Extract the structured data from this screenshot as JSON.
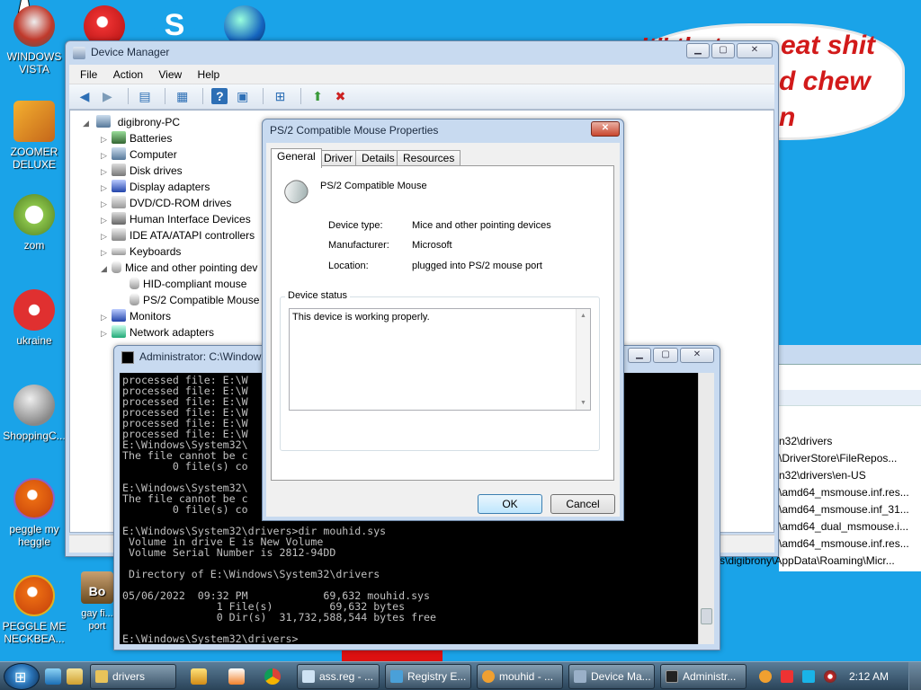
{
  "desktop": {
    "icons": [
      {
        "label": "WINDOWS VISTA",
        "icon": "windows-vista-icon",
        "color": "#c0392b"
      },
      {
        "label": "ZOOMER DELUXE",
        "icon": "zoomer-icon",
        "color": "#e08a1e"
      },
      {
        "label": "zom",
        "icon": "zombie-plant-icon",
        "color": "#8bc34a"
      },
      {
        "label": "ukraine",
        "icon": "radiation-icon",
        "color": "#e03030"
      },
      {
        "label": "ShoppingC...",
        "icon": "flash-icon",
        "color": "#777777"
      },
      {
        "label": "peggle my heggle",
        "icon": "peggle-icon",
        "color": "#ea6b12"
      },
      {
        "label": "PEGGLE ME NECKBEA...",
        "icon": "peggle-icon",
        "color": "#ea6b12"
      }
    ],
    "top_icons": [
      "peggle-icon",
      "skype-icon",
      "globe-icon"
    ],
    "partial_icon_text": "Bo",
    "partial_icon_label": "gay fi...",
    "partial_icon_label2": "port",
    "bubble_lines": [
      "It'' that",
      "eat shit",
      "d chew",
      "n"
    ]
  },
  "device_manager": {
    "title": "Device Manager",
    "menu": [
      "File",
      "Action",
      "View",
      "Help"
    ],
    "root": "digibrony-PC",
    "tree": [
      {
        "label": "Batteries",
        "expanded": false
      },
      {
        "label": "Computer",
        "expanded": false
      },
      {
        "label": "Disk drives",
        "expanded": false
      },
      {
        "label": "Display adapters",
        "expanded": false
      },
      {
        "label": "DVD/CD-ROM drives",
        "expanded": false
      },
      {
        "label": "Human Interface Devices",
        "expanded": false
      },
      {
        "label": "IDE ATA/ATAPI controllers",
        "expanded": false
      },
      {
        "label": "Keyboards",
        "expanded": false
      },
      {
        "label": "Mice and other pointing dev",
        "expanded": true
      },
      {
        "label": "HID-compliant mouse",
        "child": true
      },
      {
        "label": "PS/2 Compatible Mouse",
        "child": true
      },
      {
        "label": "Monitors",
        "expanded": false
      },
      {
        "label": "Network adapters",
        "expanded": false
      }
    ]
  },
  "properties_dialog": {
    "title": "PS/2 Compatible Mouse Properties",
    "tabs": [
      "General",
      "Driver",
      "Details",
      "Resources"
    ],
    "device_name": "PS/2 Compatible Mouse",
    "device_type_label": "Device type:",
    "device_type": "Mice and other pointing devices",
    "manufacturer_label": "Manufacturer:",
    "manufacturer": "Microsoft",
    "location_label": "Location:",
    "location": "plugged into PS/2 mouse port",
    "status_group": "Device status",
    "status_text": "This device is working properly.",
    "ok": "OK",
    "cancel": "Cancel"
  },
  "cmd": {
    "title": "Administrator: C:\\Windows",
    "lines": [
      "processed file: E:\\W",
      "processed file: E:\\W",
      "processed file: E:\\W",
      "processed file: E:\\W",
      "processed file: E:\\W",
      "processed file: E:\\W",
      "E:\\Windows\\System32\\",
      "The file cannot be c",
      "        0 file(s) co",
      "",
      "E:\\Windows\\System32\\                                         s",
      "The file cannot be c",
      "        0 file(s) co",
      "",
      "E:\\Windows\\System32\\drivers>dir mouhid.sys",
      " Volume in drive E is New Volume",
      " Volume Serial Number is 2812-94DD",
      "",
      " Directory of E:\\Windows\\System32\\drivers",
      "",
      "05/06/2022  09:32 PM            69,632 mouhid.sys",
      "               1 File(s)         69,632 bytes",
      "               0 Dir(s)  31,732,588,544 bytes free",
      "",
      "E:\\Windows\\System32\\drivers>"
    ]
  },
  "explorer_bg": {
    "rows": [
      "n32\\drivers",
      "\\DriverStore\\FileRepos...",
      "n32\\drivers\\en-US",
      "\\amd64_msmouse.inf.res...",
      "\\amd64_msmouse.inf_31...",
      "\\amd64_dual_msmouse.i...",
      "\\amd64_msmouse.inf.res...",
      "s\\digibrony\\AppData\\Roaming\\Micr..."
    ]
  },
  "taskbar": {
    "tasks": [
      {
        "label": "drivers",
        "icon": "folder-icon",
        "color": "#e8c35a"
      },
      {
        "label": "ass.reg - ...",
        "icon": "notepad-icon",
        "color": "#cfe3f4"
      },
      {
        "label": "Registry E...",
        "icon": "registry-icon",
        "color": "#4aa0d8"
      },
      {
        "label": "mouhid - ...",
        "icon": "search-icon",
        "color": "#f0a030"
      },
      {
        "label": "Device Ma...",
        "icon": "device-manager-icon",
        "color": "#9ab0c8"
      },
      {
        "label": "Administr...",
        "icon": "cmd-icon",
        "color": "#222222"
      }
    ],
    "time": "2:12 AM"
  }
}
